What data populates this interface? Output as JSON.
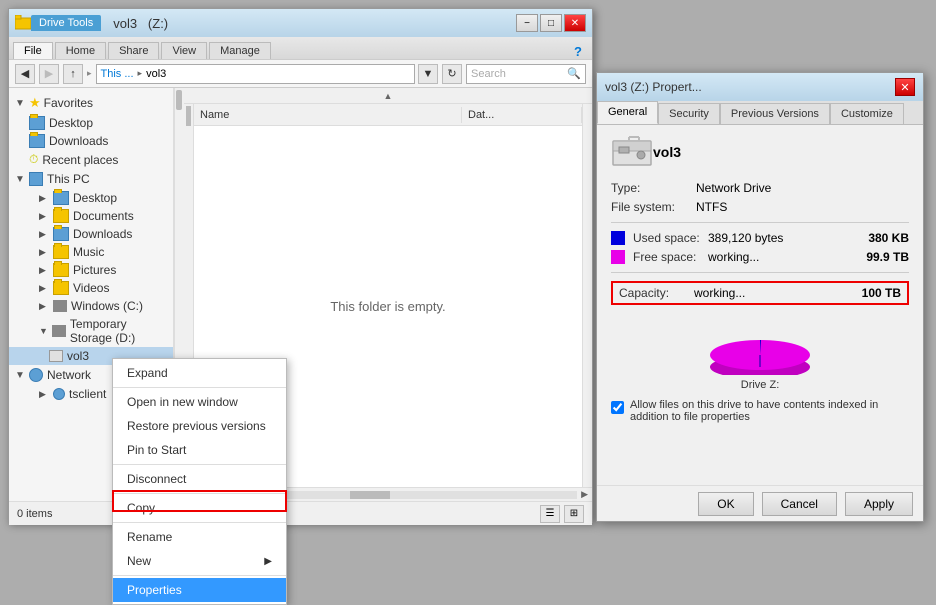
{
  "explorer": {
    "title": "vol3",
    "drive_tools": "Drive Tools",
    "title_suffix": "(Z:)",
    "tabs": [
      "File",
      "Home",
      "Share",
      "View",
      "Manage"
    ],
    "active_tab": "File",
    "address": {
      "path": "This ... ▸ vol3",
      "this_label": "This ...",
      "arrow": "▸",
      "vol3": "vol3"
    },
    "search_placeholder": "Search",
    "columns": {
      "name": "Name",
      "date": "Dat..."
    },
    "empty_message": "This folder is empty.",
    "status": "0 items",
    "sidebar": {
      "favorites_label": "Favorites",
      "desktop_label": "Desktop",
      "downloads_label": "Downloads",
      "recent_label": "Recent places",
      "thispc_label": "This PC",
      "desktop2_label": "Desktop",
      "documents_label": "Documents",
      "downloads2_label": "Downloads",
      "music_label": "Music",
      "pictures_label": "Pictures",
      "videos_label": "Videos",
      "windows_c_label": "Windows (C:)",
      "temp_storage_d_label": "Temporary Storage (D:)",
      "vol3_label": "vol3",
      "network_label": "Network",
      "tsclient_label": "tsclient"
    },
    "context_menu": {
      "expand": "Expand",
      "open_new_window": "Open in new window",
      "restore_previous": "Restore previous versions",
      "pin_to_start": "Pin to Start",
      "disconnect": "Disconnect",
      "copy": "Copy",
      "rename": "Rename",
      "new": "New",
      "properties": "Properties"
    }
  },
  "properties": {
    "title": "vol3",
    "title_suffix": "(Z:) Propert...",
    "tabs": [
      "General",
      "Security",
      "Previous Versions",
      "Customize"
    ],
    "active_tab": "General",
    "drive_name": "vol3",
    "type_label": "Type:",
    "type_value": "Network Drive",
    "filesystem_label": "File system:",
    "filesystem_value": "NTFS",
    "used_space_label": "Used space:",
    "used_space_bytes": "389,120 bytes",
    "used_space_human": "380 KB",
    "free_space_label": "Free space:",
    "free_space_bytes": "working...",
    "free_space_human": "99.9 TB",
    "capacity_label": "Capacity:",
    "capacity_bytes": "working...",
    "capacity_human": "100 TB",
    "pie_label": "Drive Z:",
    "checkbox_text": "Allow files on this drive to have contents indexed in addition to file properties",
    "ok_label": "OK",
    "cancel_label": "Cancel",
    "apply_label": "Apply",
    "used_color": "#0000dd",
    "free_color": "#e800e8"
  }
}
